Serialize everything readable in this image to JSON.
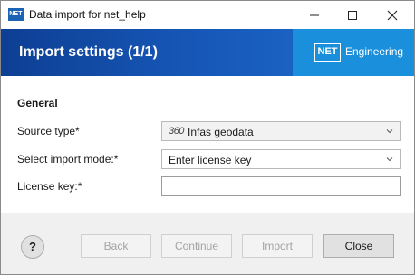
{
  "window": {
    "title": "Data import for net_help",
    "app_icon_text": "NET"
  },
  "banner": {
    "title": "Import settings (1/1)",
    "brand_mark": "NET",
    "brand_text": "Engineering"
  },
  "form": {
    "section_title": "General",
    "source_type_label": "Source type*",
    "source_type_value": "Infas geodata",
    "source_type_icon": "360",
    "import_mode_label": "Select import mode:*",
    "import_mode_value": "Enter license key",
    "license_key_label": "License key:*",
    "license_key_value": ""
  },
  "footer": {
    "help_label": "?",
    "back_label": "Back",
    "continue_label": "Continue",
    "import_label": "Import",
    "close_label": "Close"
  }
}
